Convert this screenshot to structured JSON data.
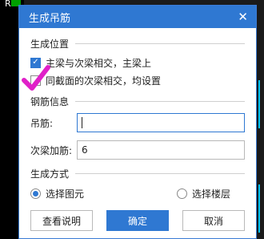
{
  "background": {
    "glyph": "R"
  },
  "dialog": {
    "title": "生成吊筋",
    "close_icon": "close-icon",
    "sections": {
      "position": {
        "title": "生成位置",
        "options": [
          {
            "label": "主梁与次梁相交，主梁上",
            "checked": true
          },
          {
            "label": "同截面的次梁相交，均设置",
            "checked": false
          }
        ]
      },
      "rebar": {
        "title": "钢筋信息",
        "hanger_label": "吊筋:",
        "hanger_value": "",
        "secondary_label": "次梁加筋:",
        "secondary_value": "6"
      },
      "method": {
        "title": "生成方式",
        "options": [
          {
            "label": "选择图元",
            "selected": true
          },
          {
            "label": "选择楼层",
            "selected": false
          }
        ]
      }
    },
    "buttons": {
      "help": "查看说明",
      "ok": "确定",
      "cancel": "取消"
    }
  },
  "colors": {
    "accent": "#2f78d2",
    "annotation": "#e020c8"
  }
}
